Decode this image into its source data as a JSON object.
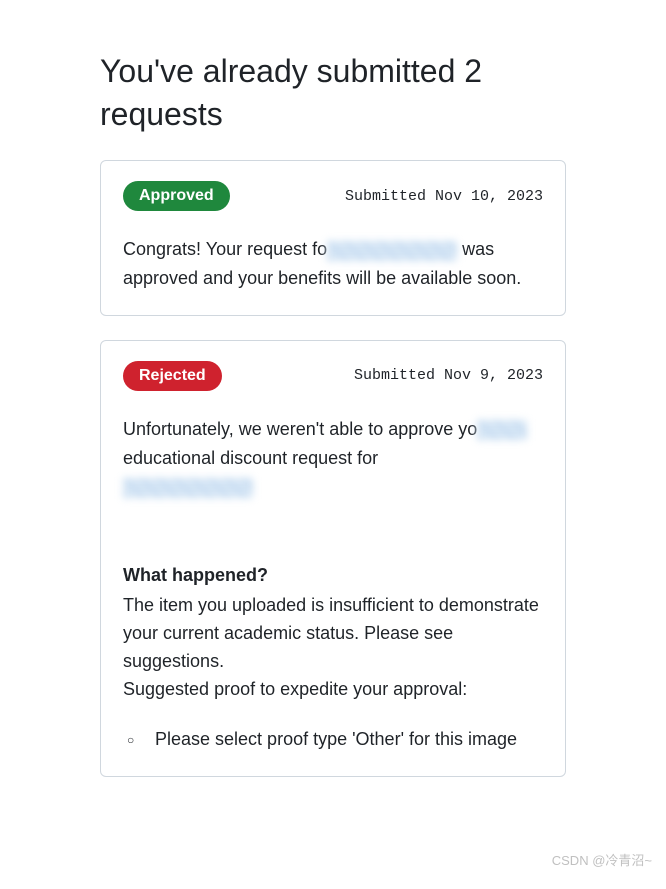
{
  "page": {
    "title": "You've already submitted 2 requests"
  },
  "requests": [
    {
      "status_label": "Approved",
      "submitted_text": "Submitted Nov 10, 2023",
      "message_prefix": "Congrats! Your request fo",
      "message_suffix": "was approved and your benefits will be available soon."
    },
    {
      "status_label": "Rejected",
      "submitted_text": "Submitted Nov 9, 2023",
      "message_prefix": "Unfortunately, we weren't able to approve yo",
      "message_mid": "educational discount request for",
      "what_happened_heading": "What happened?",
      "what_happened_body": "The item you uploaded is insufficient to demonstrate your current academic status. Please see suggestions.",
      "suggested_proof_intro": "Suggested proof to expedite your approval:",
      "suggestions": [
        "Please select proof type 'Other' for this image"
      ]
    }
  ],
  "watermark": "CSDN @冷青沼~"
}
